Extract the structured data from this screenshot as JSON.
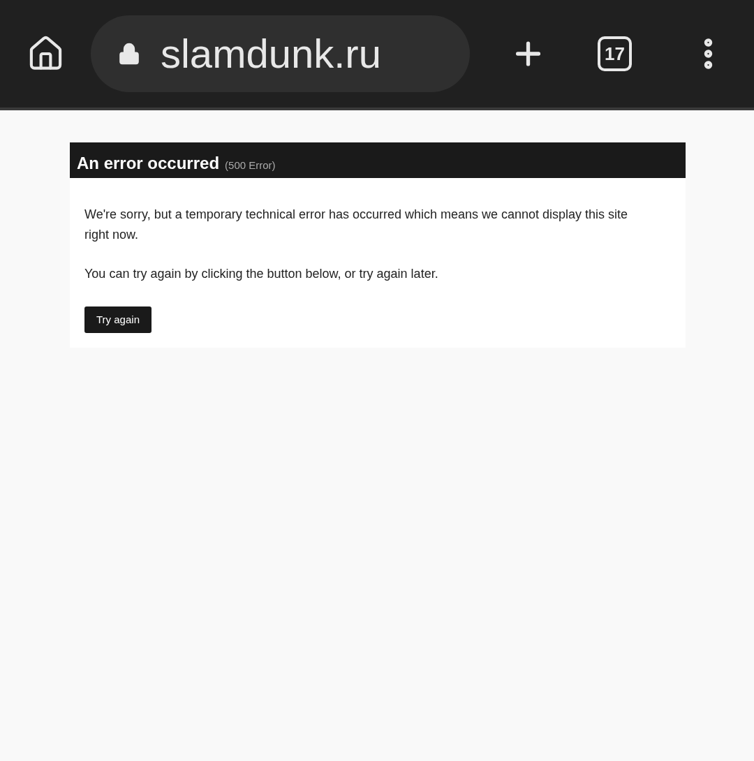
{
  "toolbar": {
    "url": "slamdunk.ru",
    "tab_count": "17"
  },
  "error": {
    "title": "An error occurred",
    "code": "(500 Error)",
    "paragraphs": [
      "We're sorry, but a temporary technical error has occurred which means we cannot display this site right now.",
      "You can try again by clicking the button below, or try again later."
    ],
    "button": "Try again"
  }
}
